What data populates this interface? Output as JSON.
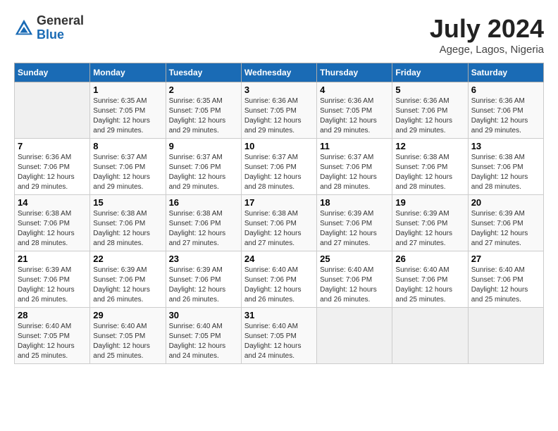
{
  "header": {
    "logo_general": "General",
    "logo_blue": "Blue",
    "month_year": "July 2024",
    "location": "Agege, Lagos, Nigeria"
  },
  "days_of_week": [
    "Sunday",
    "Monday",
    "Tuesday",
    "Wednesday",
    "Thursday",
    "Friday",
    "Saturday"
  ],
  "weeks": [
    [
      {
        "day": "",
        "info": ""
      },
      {
        "day": "1",
        "info": "Sunrise: 6:35 AM\nSunset: 7:05 PM\nDaylight: 12 hours\nand 29 minutes."
      },
      {
        "day": "2",
        "info": "Sunrise: 6:35 AM\nSunset: 7:05 PM\nDaylight: 12 hours\nand 29 minutes."
      },
      {
        "day": "3",
        "info": "Sunrise: 6:36 AM\nSunset: 7:05 PM\nDaylight: 12 hours\nand 29 minutes."
      },
      {
        "day": "4",
        "info": "Sunrise: 6:36 AM\nSunset: 7:05 PM\nDaylight: 12 hours\nand 29 minutes."
      },
      {
        "day": "5",
        "info": "Sunrise: 6:36 AM\nSunset: 7:06 PM\nDaylight: 12 hours\nand 29 minutes."
      },
      {
        "day": "6",
        "info": "Sunrise: 6:36 AM\nSunset: 7:06 PM\nDaylight: 12 hours\nand 29 minutes."
      }
    ],
    [
      {
        "day": "7",
        "info": "Sunrise: 6:36 AM\nSunset: 7:06 PM\nDaylight: 12 hours\nand 29 minutes."
      },
      {
        "day": "8",
        "info": "Sunrise: 6:37 AM\nSunset: 7:06 PM\nDaylight: 12 hours\nand 29 minutes."
      },
      {
        "day": "9",
        "info": "Sunrise: 6:37 AM\nSunset: 7:06 PM\nDaylight: 12 hours\nand 29 minutes."
      },
      {
        "day": "10",
        "info": "Sunrise: 6:37 AM\nSunset: 7:06 PM\nDaylight: 12 hours\nand 28 minutes."
      },
      {
        "day": "11",
        "info": "Sunrise: 6:37 AM\nSunset: 7:06 PM\nDaylight: 12 hours\nand 28 minutes."
      },
      {
        "day": "12",
        "info": "Sunrise: 6:38 AM\nSunset: 7:06 PM\nDaylight: 12 hours\nand 28 minutes."
      },
      {
        "day": "13",
        "info": "Sunrise: 6:38 AM\nSunset: 7:06 PM\nDaylight: 12 hours\nand 28 minutes."
      }
    ],
    [
      {
        "day": "14",
        "info": "Sunrise: 6:38 AM\nSunset: 7:06 PM\nDaylight: 12 hours\nand 28 minutes."
      },
      {
        "day": "15",
        "info": "Sunrise: 6:38 AM\nSunset: 7:06 PM\nDaylight: 12 hours\nand 28 minutes."
      },
      {
        "day": "16",
        "info": "Sunrise: 6:38 AM\nSunset: 7:06 PM\nDaylight: 12 hours\nand 27 minutes."
      },
      {
        "day": "17",
        "info": "Sunrise: 6:38 AM\nSunset: 7:06 PM\nDaylight: 12 hours\nand 27 minutes."
      },
      {
        "day": "18",
        "info": "Sunrise: 6:39 AM\nSunset: 7:06 PM\nDaylight: 12 hours\nand 27 minutes."
      },
      {
        "day": "19",
        "info": "Sunrise: 6:39 AM\nSunset: 7:06 PM\nDaylight: 12 hours\nand 27 minutes."
      },
      {
        "day": "20",
        "info": "Sunrise: 6:39 AM\nSunset: 7:06 PM\nDaylight: 12 hours\nand 27 minutes."
      }
    ],
    [
      {
        "day": "21",
        "info": "Sunrise: 6:39 AM\nSunset: 7:06 PM\nDaylight: 12 hours\nand 26 minutes."
      },
      {
        "day": "22",
        "info": "Sunrise: 6:39 AM\nSunset: 7:06 PM\nDaylight: 12 hours\nand 26 minutes."
      },
      {
        "day": "23",
        "info": "Sunrise: 6:39 AM\nSunset: 7:06 PM\nDaylight: 12 hours\nand 26 minutes."
      },
      {
        "day": "24",
        "info": "Sunrise: 6:40 AM\nSunset: 7:06 PM\nDaylight: 12 hours\nand 26 minutes."
      },
      {
        "day": "25",
        "info": "Sunrise: 6:40 AM\nSunset: 7:06 PM\nDaylight: 12 hours\nand 26 minutes."
      },
      {
        "day": "26",
        "info": "Sunrise: 6:40 AM\nSunset: 7:06 PM\nDaylight: 12 hours\nand 25 minutes."
      },
      {
        "day": "27",
        "info": "Sunrise: 6:40 AM\nSunset: 7:06 PM\nDaylight: 12 hours\nand 25 minutes."
      }
    ],
    [
      {
        "day": "28",
        "info": "Sunrise: 6:40 AM\nSunset: 7:05 PM\nDaylight: 12 hours\nand 25 minutes."
      },
      {
        "day": "29",
        "info": "Sunrise: 6:40 AM\nSunset: 7:05 PM\nDaylight: 12 hours\nand 25 minutes."
      },
      {
        "day": "30",
        "info": "Sunrise: 6:40 AM\nSunset: 7:05 PM\nDaylight: 12 hours\nand 24 minutes."
      },
      {
        "day": "31",
        "info": "Sunrise: 6:40 AM\nSunset: 7:05 PM\nDaylight: 12 hours\nand 24 minutes."
      },
      {
        "day": "",
        "info": ""
      },
      {
        "day": "",
        "info": ""
      },
      {
        "day": "",
        "info": ""
      }
    ]
  ]
}
